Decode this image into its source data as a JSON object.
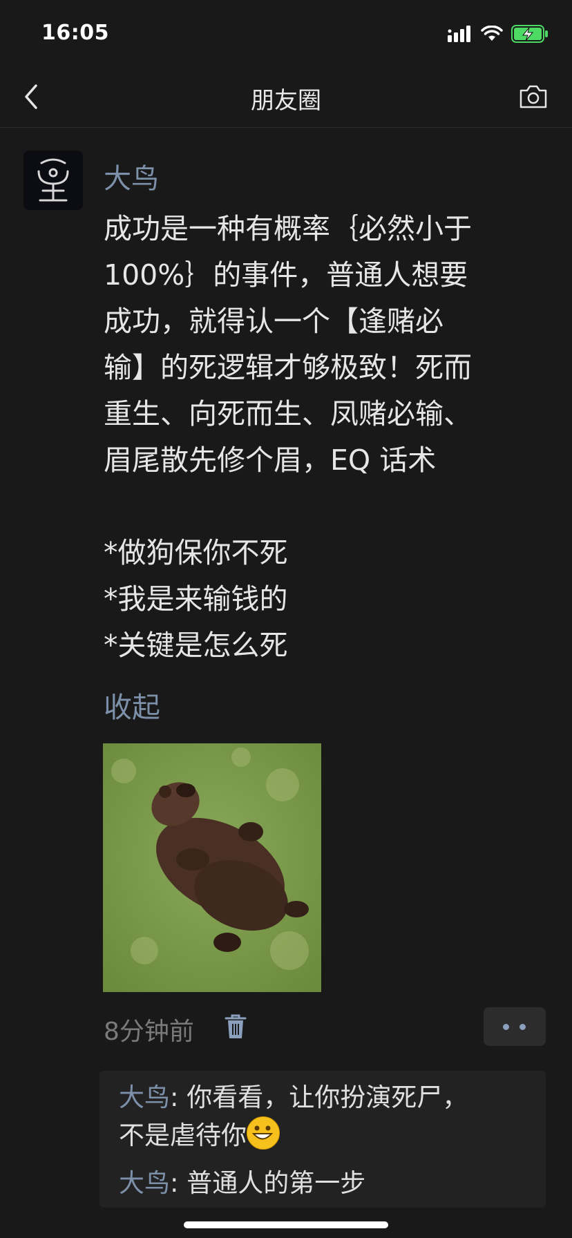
{
  "status_bar": {
    "time": "16:05"
  },
  "nav": {
    "title": "朋友圈"
  },
  "post": {
    "author": "大鸟",
    "text": "成功是一种有概率｛必然小于\n100%｝的事件，普通人想要\n成功，就得认一个【逢赌必\n输】的死逻辑才够极致！死而\n重生、向死而生、凤赌必输、\n眉尾散先修个眉，EQ 话术\n\n*做狗保你不死\n*我是来输钱的\n*关键是怎么死",
    "collapse_label": "收起",
    "timestamp": "8分钟前",
    "comments": [
      {
        "name": "大鸟",
        "text": ": 你看看，让你扮演死尸，\n不是虐待你"
      },
      {
        "name": "大鸟",
        "text": ": 普通人的第一步"
      }
    ]
  },
  "colors": {
    "background": "#191919",
    "link": "#7d90a9",
    "battery": "#4cd964"
  }
}
